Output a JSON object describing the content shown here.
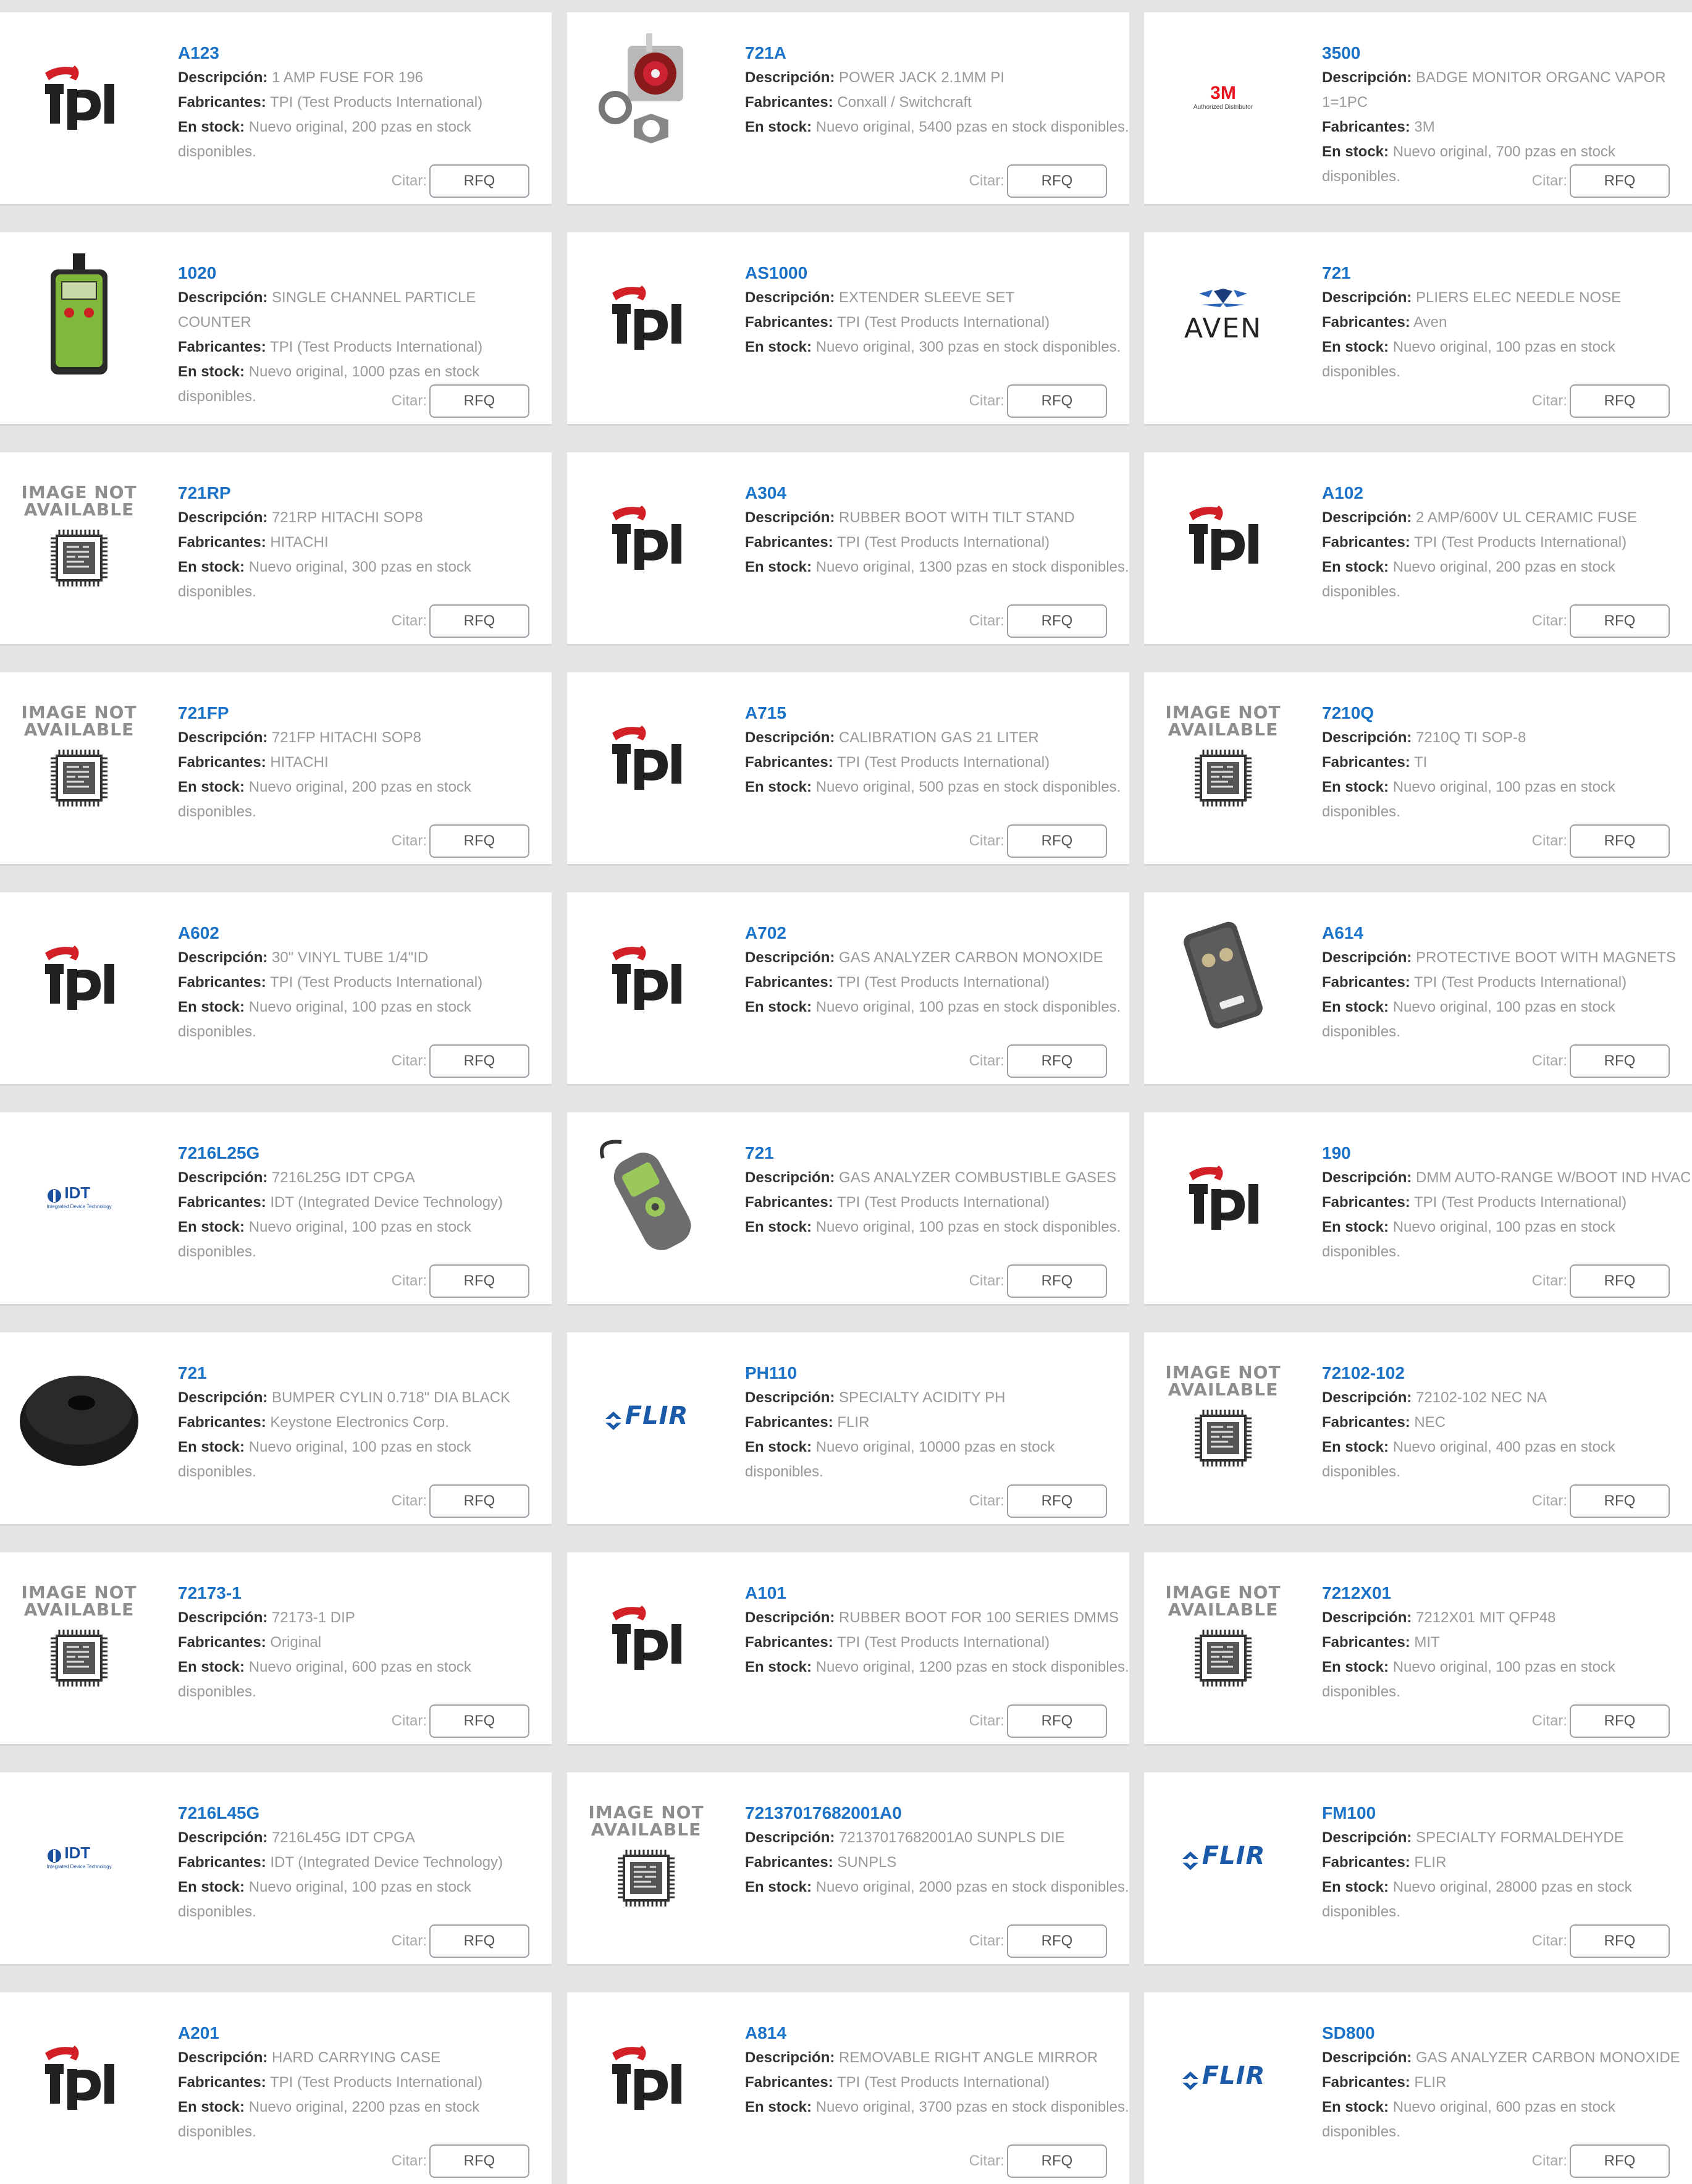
{
  "labels": {
    "description": "Descripción:",
    "manufacturer": "Fabricantes:",
    "stock": "En stock:",
    "citar": "Citar:",
    "rfq": "RFQ"
  },
  "image_not_available": [
    "IMAGE NOT",
    "AVAILABLE"
  ],
  "colors": {
    "part_number": "#1a73c9",
    "tpi_red": "#d32027",
    "flir_blue": "#1a5aa8",
    "idt_blue": "#1a4fa0",
    "m3_red": "#e8141e"
  },
  "products": [
    {
      "pn": "A123",
      "desc": "1 AMP FUSE FOR 196",
      "mfr": "TPI (Test Products International)",
      "stock": "Nuevo original, 200 pzas en stock disponibles.",
      "image": "tpi-logo"
    },
    {
      "pn": "721A",
      "desc": "POWER JACK 2.1MM PI",
      "mfr": "Conxall / Switchcraft",
      "stock": "Nuevo original, 5400 pzas en stock disponibles.",
      "image": "power-jack-photo"
    },
    {
      "pn": "3500",
      "desc": "BADGE MONITOR ORGANC VAPOR 1=1PC",
      "mfr": "3M",
      "stock": "Nuevo original, 700 pzas en stock disponibles.",
      "image": "3m-logo",
      "logo_text": "3M",
      "logo_sub": "Authorized Distributor"
    },
    {
      "pn": "1020",
      "desc": "SINGLE CHANNEL PARTICLE COUNTER",
      "mfr": "TPI (Test Products International)",
      "stock": "Nuevo original, 1000 pzas en stock disponibles.",
      "image": "particle-counter-photo"
    },
    {
      "pn": "AS1000",
      "desc": "EXTENDER SLEEVE SET",
      "mfr": "TPI (Test Products International)",
      "stock": "Nuevo original, 300 pzas en stock disponibles.",
      "image": "tpi-logo"
    },
    {
      "pn": "721",
      "desc": "PLIERS ELEC NEEDLE NOSE",
      "mfr": "Aven",
      "stock": "Nuevo original, 100 pzas en stock disponibles.",
      "image": "aven-logo",
      "logo_text": "AVEN"
    },
    {
      "pn": "721RP",
      "desc": "721RP HITACHI SOP8",
      "mfr": "HITACHI",
      "stock": "Nuevo original, 300 pzas en stock disponibles.",
      "image": "image-not-available"
    },
    {
      "pn": "A304",
      "desc": "RUBBER BOOT WITH TILT STAND",
      "mfr": "TPI (Test Products International)",
      "stock": "Nuevo original, 1300 pzas en stock disponibles.",
      "image": "tpi-logo"
    },
    {
      "pn": "A102",
      "desc": "2 AMP/600V UL CERAMIC FUSE",
      "mfr": "TPI (Test Products International)",
      "stock": "Nuevo original, 200 pzas en stock disponibles.",
      "image": "tpi-logo"
    },
    {
      "pn": "721FP",
      "desc": "721FP HITACHI SOP8",
      "mfr": "HITACHI",
      "stock": "Nuevo original, 200 pzas en stock disponibles.",
      "image": "image-not-available"
    },
    {
      "pn": "A715",
      "desc": "CALIBRATION GAS 21 LITER",
      "mfr": "TPI (Test Products International)",
      "stock": "Nuevo original, 500 pzas en stock disponibles.",
      "image": "tpi-logo"
    },
    {
      "pn": "7210Q",
      "desc": "7210Q TI SOP-8",
      "mfr": "TI",
      "stock": "Nuevo original, 100 pzas en stock disponibles.",
      "image": "image-not-available"
    },
    {
      "pn": "A602",
      "desc": "30\" VINYL TUBE 1/4\"ID",
      "mfr": "TPI (Test Products International)",
      "stock": "Nuevo original, 100 pzas en stock disponibles.",
      "image": "tpi-logo"
    },
    {
      "pn": "A702",
      "desc": "GAS ANALYZER CARBON MONOXIDE",
      "mfr": "TPI (Test Products International)",
      "stock": "Nuevo original, 100 pzas en stock disponibles.",
      "image": "tpi-logo"
    },
    {
      "pn": "A614",
      "desc": "PROTECTIVE BOOT WITH MAGNETS",
      "mfr": "TPI (Test Products International)",
      "stock": "Nuevo original, 100 pzas en stock disponibles.",
      "image": "protective-boot-photo"
    },
    {
      "pn": "7216L25G",
      "desc": "7216L25G IDT CPGA",
      "mfr": "IDT (Integrated Device Technology)",
      "stock": "Nuevo original, 100 pzas en stock disponibles.",
      "image": "idt-logo",
      "logo_text": "IDT",
      "logo_sub": "Integrated Device Technology"
    },
    {
      "pn": "721",
      "desc": "GAS ANALYZER COMBUSTIBLE GASES",
      "mfr": "TPI (Test Products International)",
      "stock": "Nuevo original, 100 pzas en stock disponibles.",
      "image": "gas-analyzer-photo"
    },
    {
      "pn": "190",
      "desc": "DMM AUTO-RANGE W/BOOT IND HVAC",
      "mfr": "TPI (Test Products International)",
      "stock": "Nuevo original, 100 pzas en stock disponibles.",
      "image": "tpi-logo"
    },
    {
      "pn": "721",
      "desc": "BUMPER CYLIN 0.718\" DIA BLACK",
      "mfr": "Keystone Electronics Corp.",
      "stock": "Nuevo original, 100 pzas en stock disponibles.",
      "image": "bumper-photo"
    },
    {
      "pn": "PH110",
      "desc": "SPECIALTY ACIDITY PH",
      "mfr": "FLIR",
      "stock": "Nuevo original, 10000 pzas en stock disponibles.",
      "image": "flir-logo",
      "logo_text": "FLIR"
    },
    {
      "pn": "72102-102",
      "desc": "72102-102 NEC NA",
      "mfr": "NEC",
      "stock": "Nuevo original, 400 pzas en stock disponibles.",
      "image": "image-not-available"
    },
    {
      "pn": "72173-1",
      "desc": "72173-1    DIP",
      "mfr": "Original",
      "stock": "Nuevo original, 600 pzas en stock disponibles.",
      "image": "image-not-available"
    },
    {
      "pn": "A101",
      "desc": "RUBBER BOOT FOR 100 SERIES DMMS",
      "mfr": "TPI (Test Products International)",
      "stock": "Nuevo original, 1200 pzas en stock disponibles.",
      "image": "tpi-logo"
    },
    {
      "pn": "7212X01",
      "desc": "7212X01 MIT QFP48",
      "mfr": "MIT",
      "stock": "Nuevo original, 100 pzas en stock disponibles.",
      "image": "image-not-available"
    },
    {
      "pn": "7216L45G",
      "desc": "7216L45G IDT CPGA",
      "mfr": "IDT (Integrated Device Technology)",
      "stock": "Nuevo original, 100 pzas en stock disponibles.",
      "image": "idt-logo",
      "logo_text": "IDT",
      "logo_sub": "Integrated Device Technology"
    },
    {
      "pn": "72137017682001A0",
      "desc": "72137017682001A0 SUNPLS DIE",
      "mfr": "SUNPLS",
      "stock": "Nuevo original, 2000 pzas en stock disponibles.",
      "image": "image-not-available"
    },
    {
      "pn": "FM100",
      "desc": "SPECIALTY FORMALDEHYDE",
      "mfr": "FLIR",
      "stock": "Nuevo original, 28000 pzas en stock disponibles.",
      "image": "flir-logo",
      "logo_text": "FLIR"
    },
    {
      "pn": "A201",
      "desc": "HARD CARRYING CASE",
      "mfr": "TPI (Test Products International)",
      "stock": "Nuevo original, 2200 pzas en stock disponibles.",
      "image": "tpi-logo"
    },
    {
      "pn": "A814",
      "desc": "REMOVABLE RIGHT ANGLE MIRROR",
      "mfr": "TPI (Test Products International)",
      "stock": "Nuevo original, 3700 pzas en stock disponibles.",
      "image": "tpi-logo"
    },
    {
      "pn": "SD800",
      "desc": "GAS ANALYZER CARBON MONOXIDE",
      "mfr": "FLIR",
      "stock": "Nuevo original, 600 pzas en stock disponibles.",
      "image": "flir-logo",
      "logo_text": "FLIR"
    }
  ]
}
